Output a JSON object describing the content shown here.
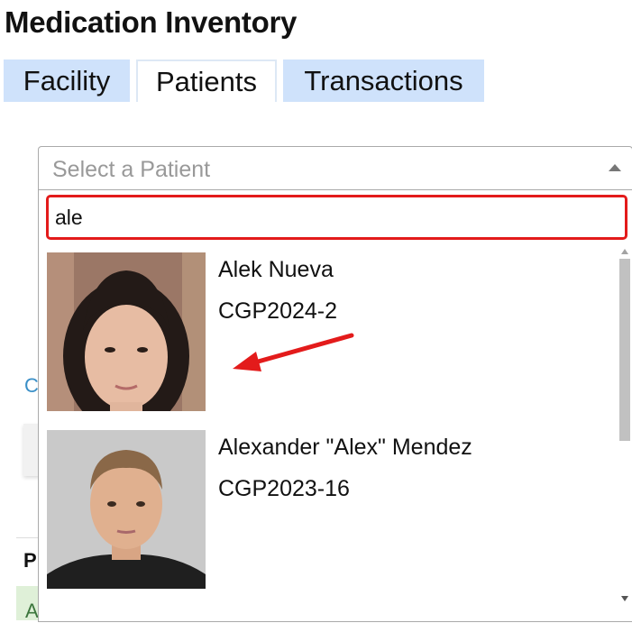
{
  "page": {
    "title": "Medication Inventory"
  },
  "tabs": [
    {
      "label": "Facility",
      "active": false
    },
    {
      "label": "Patients",
      "active": true
    },
    {
      "label": "Transactions",
      "active": false
    }
  ],
  "patient_select": {
    "placeholder": "Select a Patient",
    "search_value": "ale",
    "results": [
      {
        "name": "Alek Nueva",
        "id": "CGP2024-2"
      },
      {
        "name": "Alexander \"Alex\" Mendez",
        "id": "CGP2023-16"
      }
    ]
  },
  "background_fragments": {
    "link_fragment": "C",
    "heading_fragment": "P",
    "green_fragment": "A"
  },
  "annotation": {
    "color": "#e31b1b"
  },
  "colors": {
    "tab_bg": "#cfe2fb",
    "highlight": "#e31b1b",
    "placeholder": "#999999"
  }
}
